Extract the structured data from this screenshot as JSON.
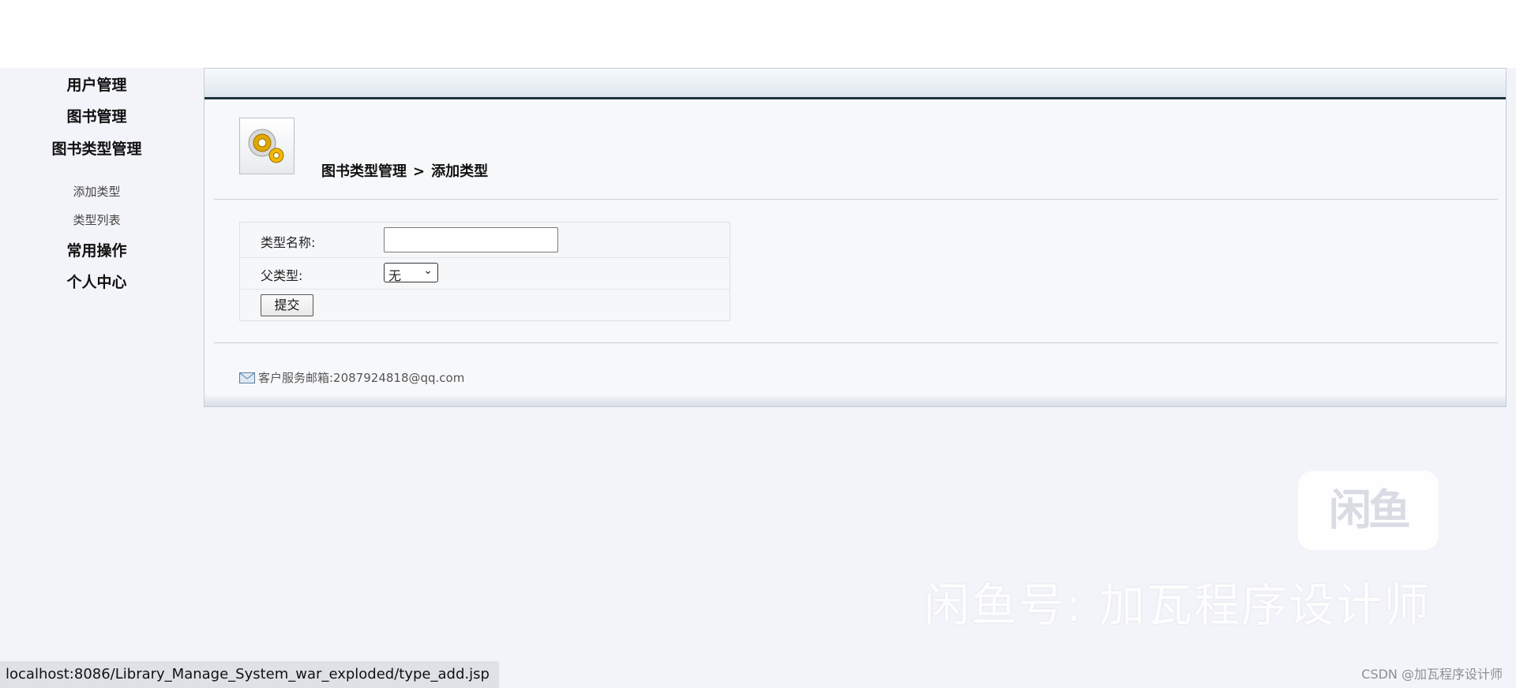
{
  "sidebar": {
    "user_mgmt": "用户管理",
    "book_mgmt": "图书管理",
    "book_type_mgmt": "图书类型管理",
    "add_type": "添加类型",
    "type_list": "类型列表",
    "common_ops": "常用操作",
    "personal_center": "个人中心"
  },
  "breadcrumb": {
    "parent": "图书类型管理",
    "separator": ">",
    "current": "添加类型"
  },
  "form": {
    "type_name_label": "类型名称:",
    "type_name_value": "",
    "parent_type_label": "父类型:",
    "parent_type_selected": "无",
    "submit_label": "提交"
  },
  "footer": {
    "email_text": "客户服务邮箱:2087924818@qq.com"
  },
  "watermark": {
    "logo_text": "闲鱼",
    "handle_text": "闲鱼号: 加瓦程序设计师",
    "csdn_text": "CSDN @加瓦程序设计师"
  },
  "status_bar": {
    "url": "localhost:8086/Library_Manage_System_war_exploded/type_add.jsp"
  },
  "icons": {
    "header": "gear-icon",
    "email": "envelope-icon",
    "dropdown": "chevron-down-icon"
  }
}
